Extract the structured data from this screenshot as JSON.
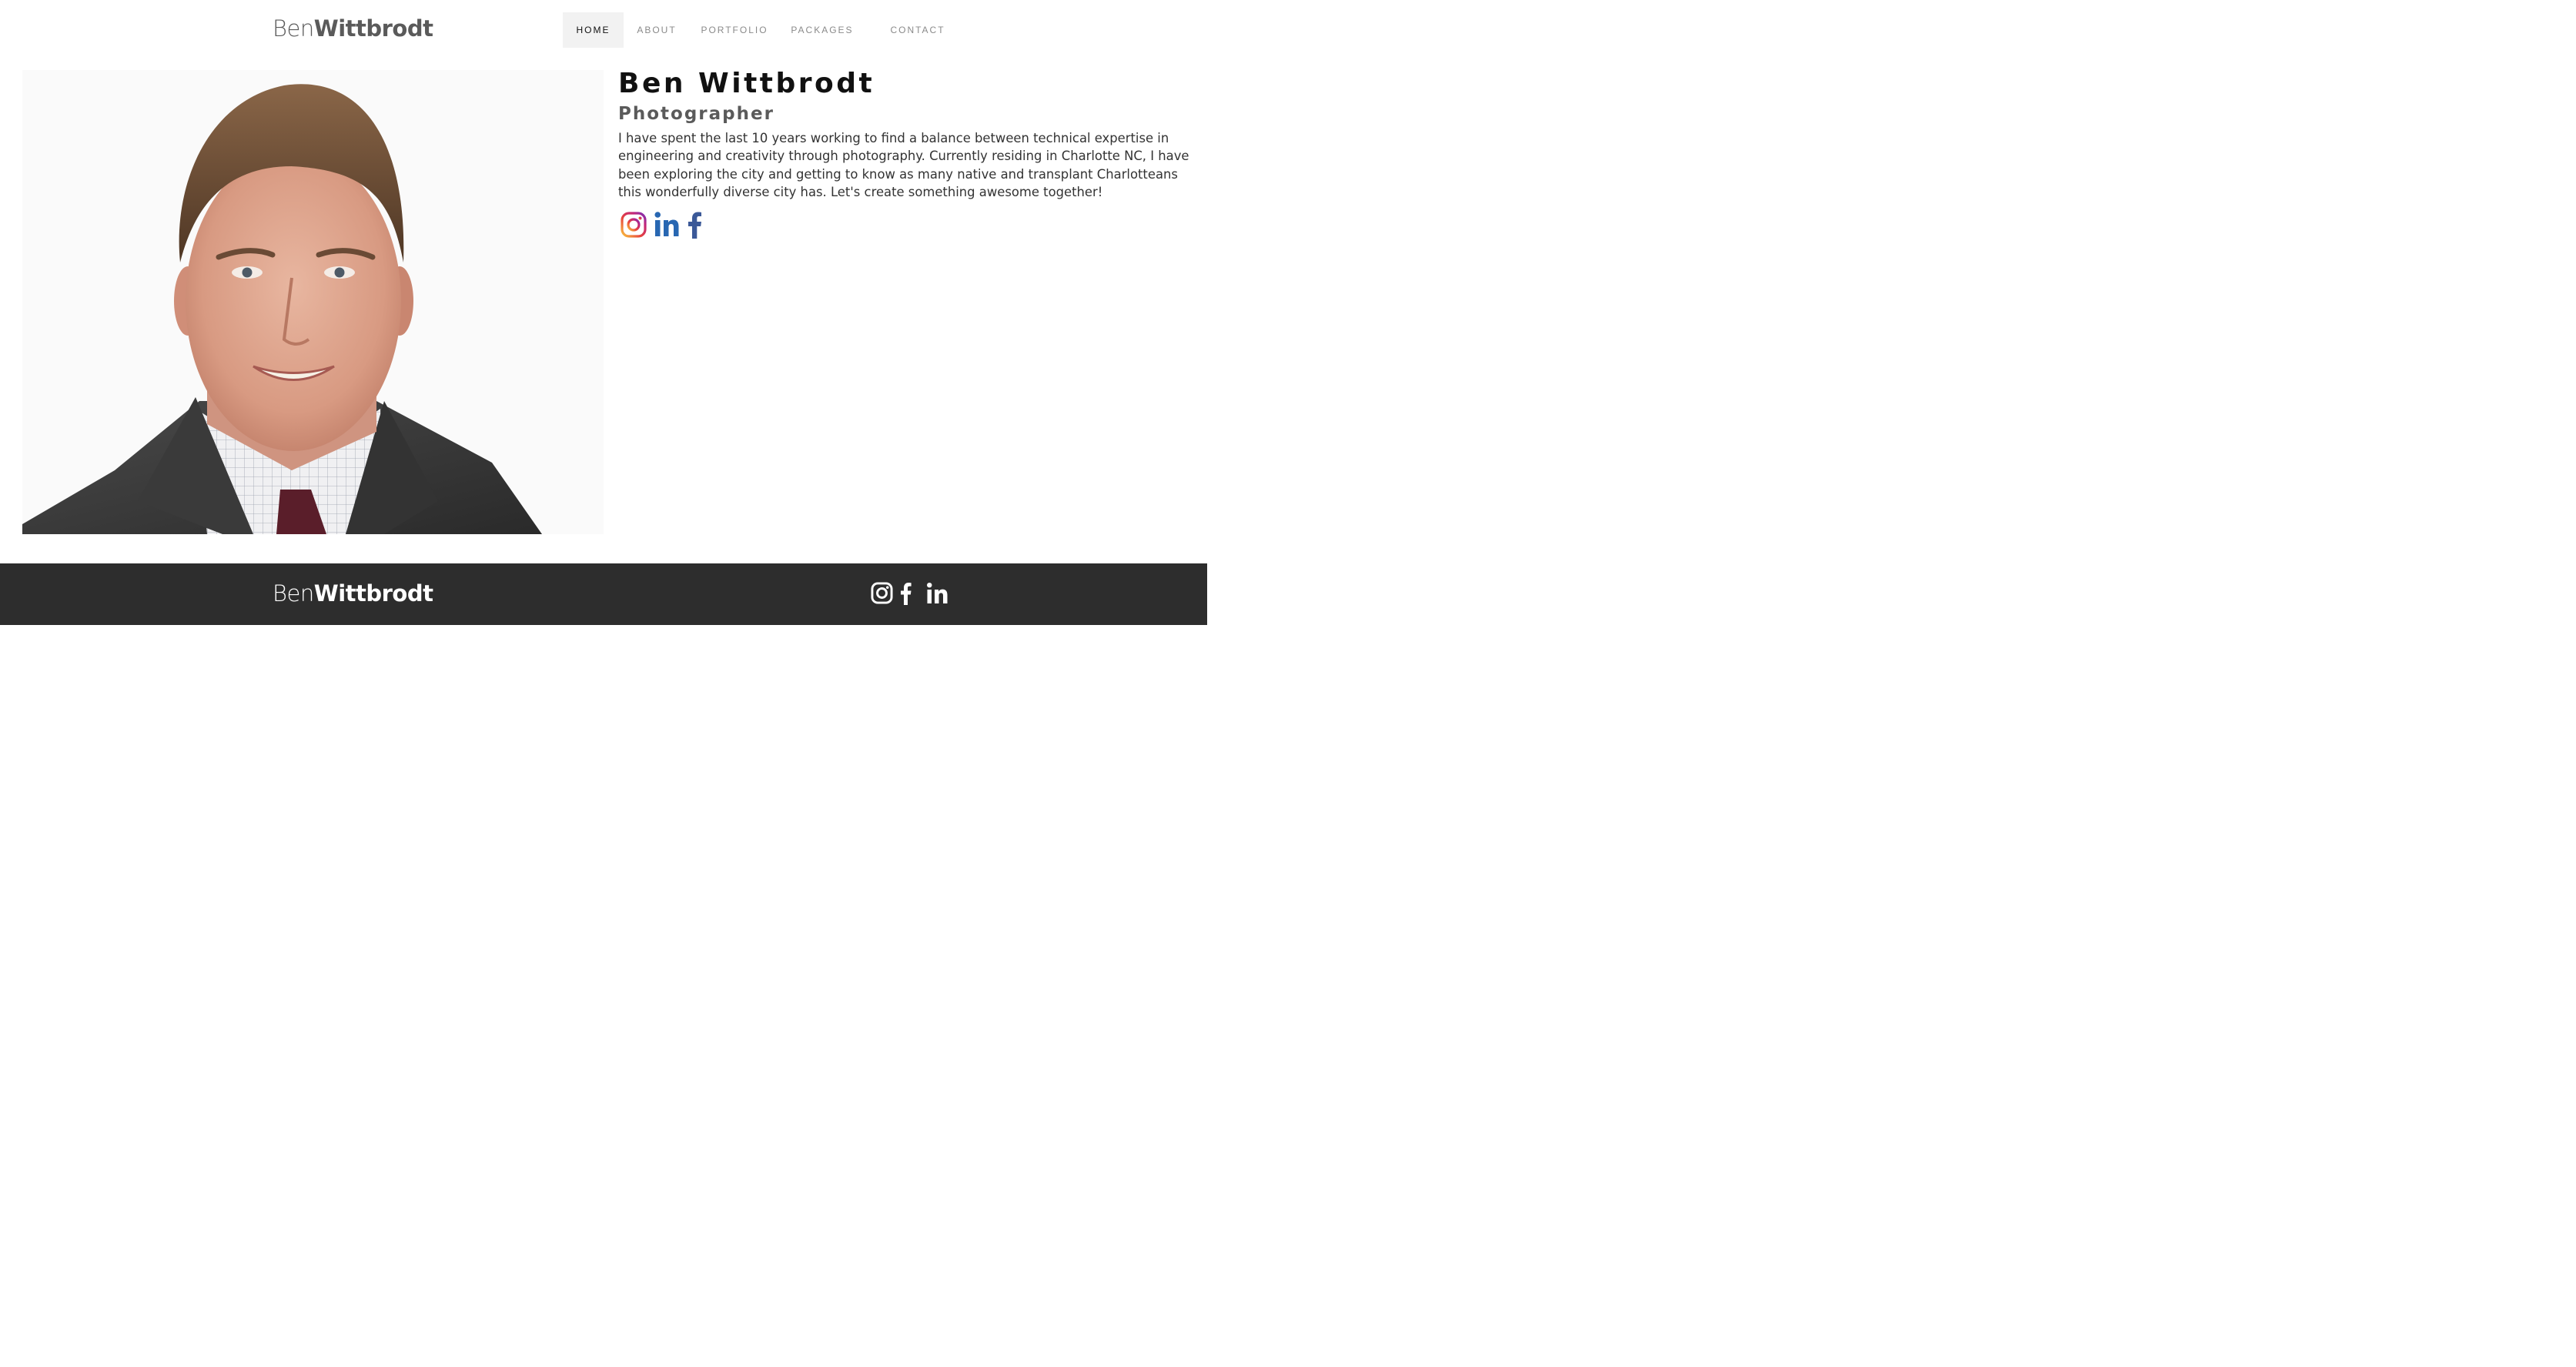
{
  "header": {
    "logo": {
      "first": "Ben",
      "last": "Wittbrodt"
    },
    "nav": [
      "HOME",
      "ABOUT",
      "PORTFOLIO",
      "PACKAGES",
      "CONTACT"
    ],
    "active_nav": "HOME"
  },
  "profile": {
    "name": "Ben Wittbrodt",
    "role": "Photographer",
    "bio": "I have spent the last 10 years working to find a balance between technical expertise in engineering and creativity through photography. Currently residing in Charlotte NC, I have been exploring the city and getting to know as many native and transplant Charlotteans this wonderfully diverse city has. Let's create something awesome together!",
    "socials": [
      "instagram-icon",
      "linkedin-icon",
      "facebook-icon"
    ]
  },
  "footer": {
    "logo": {
      "first": "Ben",
      "last": "Wittbrodt"
    },
    "socials": [
      "instagram-icon",
      "facebook-icon",
      "linkedin-icon"
    ]
  },
  "colors": {
    "footer_bg": "#2d2d2d",
    "linkedin": "#2867b2",
    "facebook": "#3b5998",
    "nav_active_bg": "#f2f2f2"
  }
}
